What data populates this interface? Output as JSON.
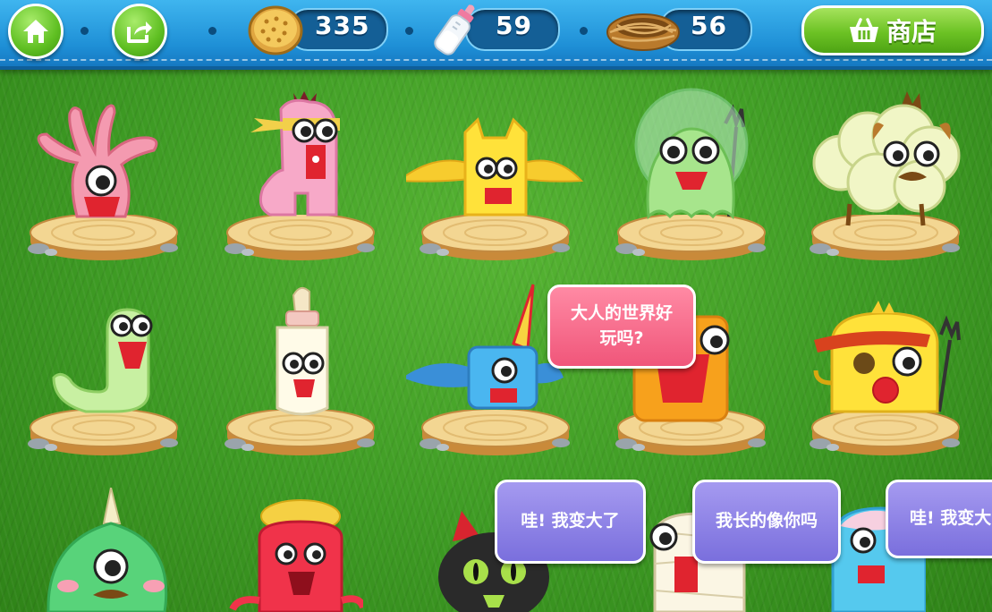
{
  "topbar": {
    "home_icon": "home-icon",
    "share_icon": "share-icon",
    "cookies": {
      "icon": "cookie-icon",
      "value": "335"
    },
    "milk": {
      "icon": "baby-bottle-icon",
      "value": "59"
    },
    "nests": {
      "icon": "nest-icon",
      "value": "56"
    },
    "shop": {
      "icon": "basket-icon",
      "label": "商店"
    }
  },
  "colors": {
    "topbar": "#1e8fd6",
    "grass": "#4aa82c",
    "button_green": "#6cc224",
    "bubble_pink": "#f0567a",
    "bubble_purple": "#7a6fdd"
  },
  "speech": {
    "pink": "大人的世界好玩吗?",
    "purple_1": "哇! 我变大了",
    "purple_2": "我长的像你吗",
    "purple_3": "哇! 我变大"
  }
}
